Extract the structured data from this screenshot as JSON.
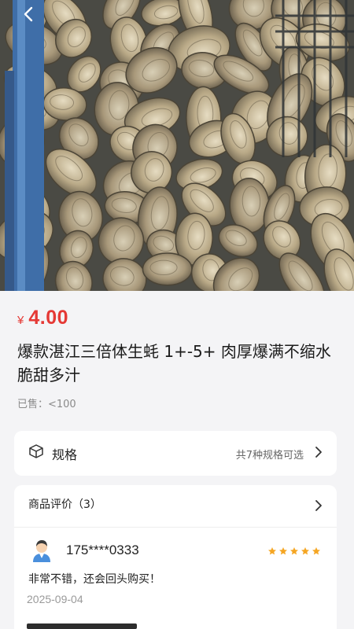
{
  "product": {
    "currency": "¥",
    "price": "4.00",
    "title": "爆款湛江三倍体生蚝 1+-5+ 肉厚爆满不缩水 脆甜多汁",
    "sold": "已售：<100"
  },
  "spec": {
    "label": "规格",
    "hint": "共7种规格可选"
  },
  "reviews": {
    "header": "商品评价（3）",
    "items": [
      {
        "user": "175****0333",
        "rating": 5,
        "text": "非常不错，还会回头购买！",
        "date": "2025-09-04"
      }
    ]
  },
  "icons": {
    "back": "chevron-left-icon",
    "spec": "box-icon",
    "arrow": "chevron-right-icon",
    "star": "star-icon",
    "avatar": "user-avatar-icon"
  },
  "colors": {
    "price": "#e53935",
    "star": "#f5a623",
    "bg": "#f4f4f6"
  }
}
